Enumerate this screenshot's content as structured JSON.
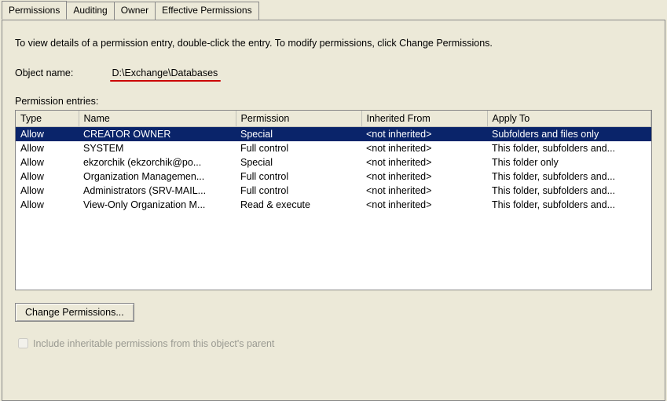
{
  "tabs": {
    "permissions": "Permissions",
    "auditing": "Auditing",
    "owner": "Owner",
    "effective": "Effective Permissions"
  },
  "instructions": "To view details of a permission entry, double-click the entry. To modify permissions, click Change Permissions.",
  "object_name_label": "Object name:",
  "object_name_value": "D:\\Exchange\\Databases",
  "entries_label": "Permission entries:",
  "columns": {
    "type": "Type",
    "name": "Name",
    "permission": "Permission",
    "inherited": "Inherited From",
    "apply": "Apply To"
  },
  "rows": [
    {
      "type": "Allow",
      "name": "CREATOR OWNER",
      "permission": "Special",
      "inherited": "<not inherited>",
      "apply": "Subfolders and files only",
      "selected": true
    },
    {
      "type": "Allow",
      "name": "SYSTEM",
      "permission": "Full control",
      "inherited": "<not inherited>",
      "apply": "This folder, subfolders and..."
    },
    {
      "type": "Allow",
      "name": "ekzorchik (ekzorchik@po...",
      "permission": "Special",
      "inherited": "<not inherited>",
      "apply": "This folder only"
    },
    {
      "type": "Allow",
      "name": "Organization Managemen...",
      "permission": "Full control",
      "inherited": "<not inherited>",
      "apply": "This folder, subfolders and..."
    },
    {
      "type": "Allow",
      "name": "Administrators (SRV-MAIL...",
      "permission": "Full control",
      "inherited": "<not inherited>",
      "apply": "This folder, subfolders and..."
    },
    {
      "type": "Allow",
      "name": "View-Only Organization M...",
      "permission": "Read & execute",
      "inherited": "<not inherited>",
      "apply": "This folder, subfolders and..."
    }
  ],
  "change_btn": "Change Permissions...",
  "include_cb": "Include inheritable permissions from this object's parent"
}
